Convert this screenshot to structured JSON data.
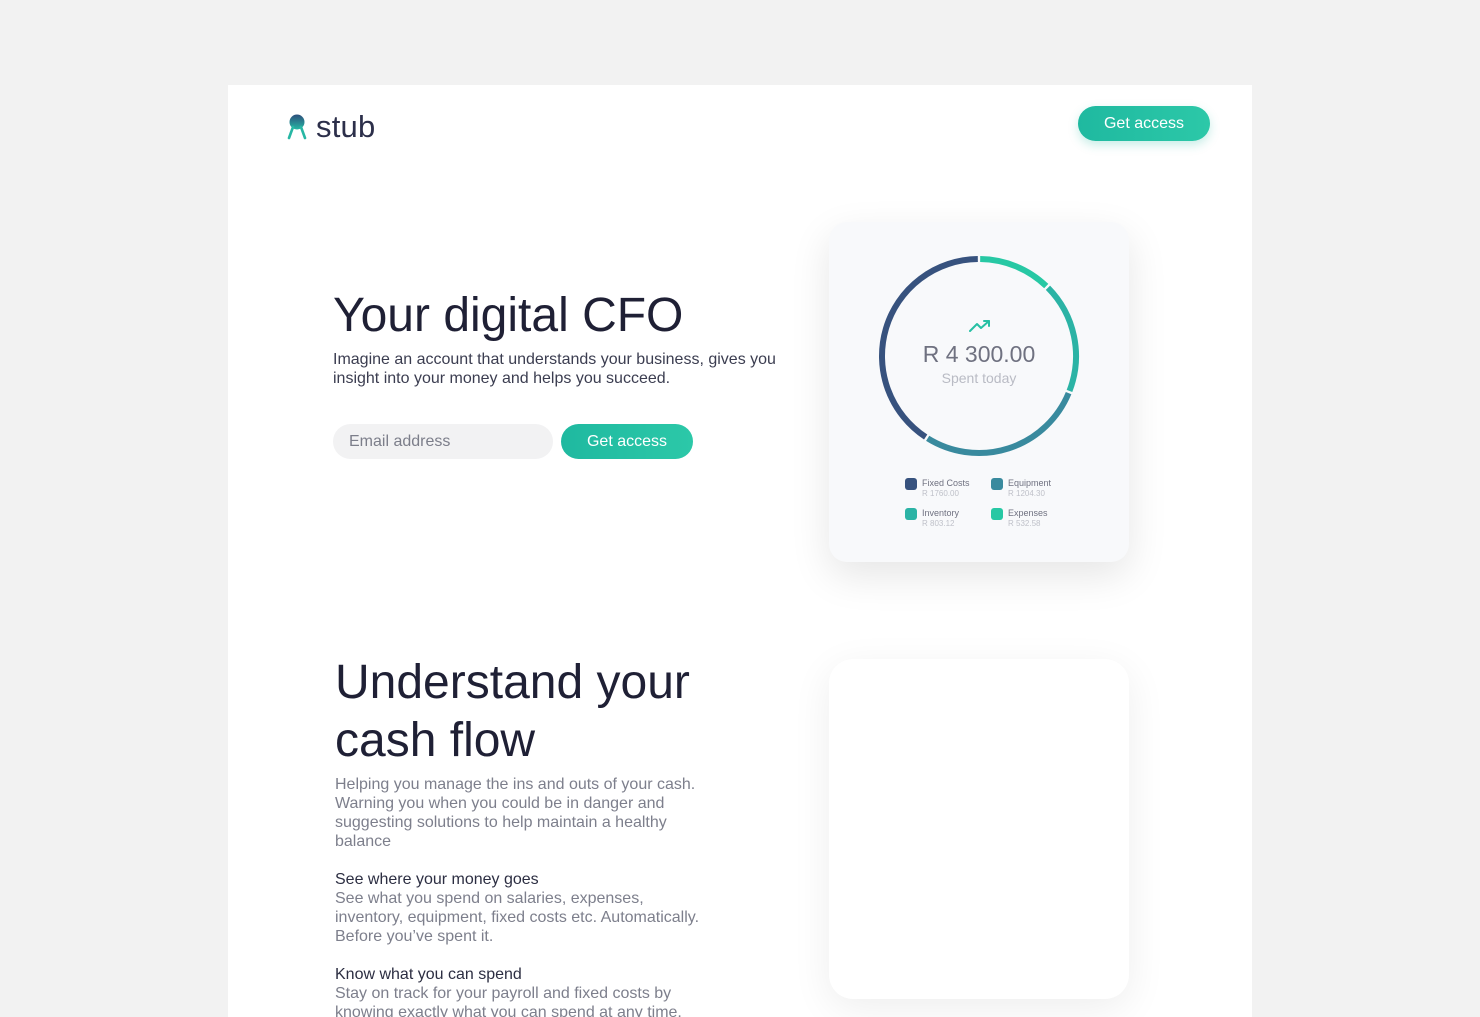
{
  "brand": {
    "name": "stub",
    "accent_color": "#26c0a4",
    "dark_color": "#2c2f4a"
  },
  "nav": {
    "cta_label": "Get access"
  },
  "hero": {
    "title": "Your digital CFO",
    "subtitle": "Imagine an account that understands your business, gives you insight into your money and helps you succeed.",
    "email_placeholder": "Email address",
    "cta_label": "Get access"
  },
  "summary_card": {
    "amount": "R 4 300.00",
    "amount_label": "Spent today",
    "icon": "trending-up-icon",
    "legend": [
      {
        "name": "Fixed Costs",
        "value": "R 1760.00",
        "color": "#37527e"
      },
      {
        "name": "Equipment",
        "value": "R 1204.30",
        "color": "#398a9e"
      },
      {
        "name": "Inventory",
        "value": "R 803.12",
        "color": "#2bb3a5"
      },
      {
        "name": "Expenses",
        "value": "R 532.58",
        "color": "#27c8a4"
      }
    ]
  },
  "chart_data": {
    "type": "pie",
    "categories": [
      "Fixed Costs",
      "Equipment",
      "Inventory",
      "Expenses"
    ],
    "values": [
      1760.0,
      1204.3,
      803.12,
      532.58
    ],
    "colors": [
      "#37527e",
      "#398a9e",
      "#2bb3a5",
      "#27c8a4"
    ],
    "style": "donut ring"
  },
  "cashflow": {
    "title": "Understand your cash flow",
    "intro": "Helping you manage the ins and outs of your cash. Warning you when you could be in danger and suggesting solutions to help maintain a healthy balance",
    "features": [
      {
        "heading": "See where your money goes",
        "text": "See what you spend on salaries, expenses, inventory, equipment, fixed costs etc. Automatically. Before you’ve spent it."
      },
      {
        "heading": "Know what you can spend",
        "text": "Stay on track for your payroll and fixed costs by knowing exactly what you can spend at any time."
      }
    ]
  }
}
